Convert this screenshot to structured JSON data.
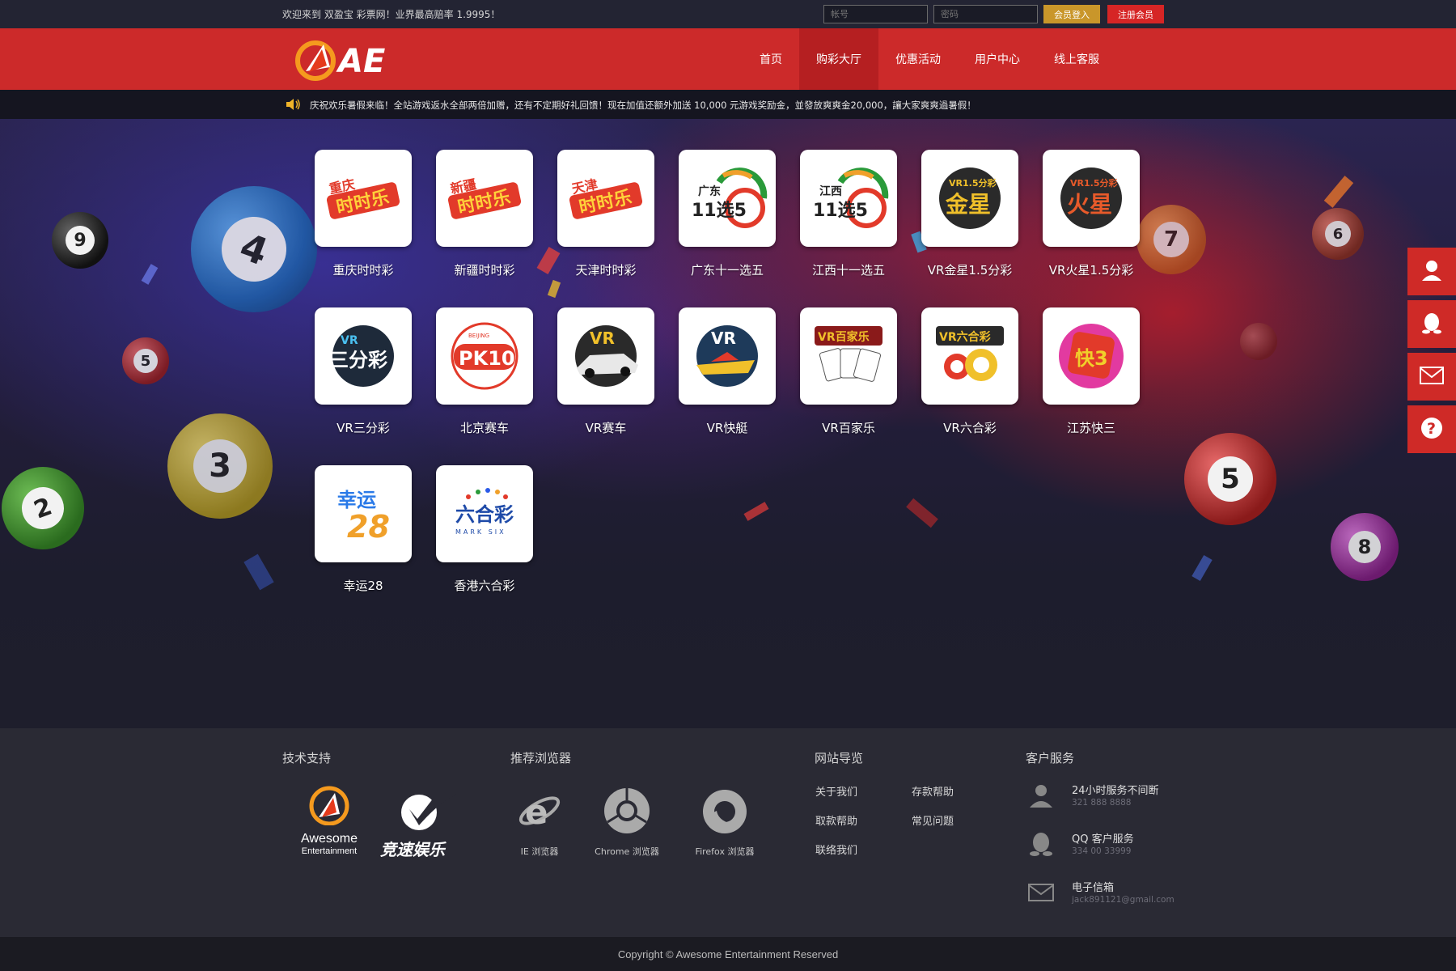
{
  "topbar": {
    "welcome": "欢迎来到 双盈宝 彩票网！业界最高赔率 1.9995！",
    "account_placeholder": "帐号",
    "password_placeholder": "密码",
    "login_label": "会员登入",
    "register_label": "注册会员"
  },
  "header": {
    "logo_text": "AE",
    "nav": [
      "首页",
      "购彩大厅",
      "优惠活动",
      "用户中心",
      "线上客服"
    ],
    "active_nav": "购彩大厅"
  },
  "marquee": {
    "text": "庆祝欢乐暑假来临！全站游戏返水全部两倍加赠，还有不定期好礼回馈！现在加值还额外加送 10,000 元游戏奖励金，並發放爽爽金20,000，讓大家爽爽過暑假！"
  },
  "games": [
    {
      "label": "重庆时时彩",
      "logo_top": "重庆",
      "logo_main": "时时乐"
    },
    {
      "label": "新疆时时彩",
      "logo_top": "新疆",
      "logo_main": "时时乐"
    },
    {
      "label": "天津时时彩",
      "logo_top": "天津",
      "logo_main": "时时乐"
    },
    {
      "label": "广东十一选五",
      "logo_top": "广东",
      "logo_main": "11选5"
    },
    {
      "label": "江西十一选五",
      "logo_top": "江西",
      "logo_main": "11选5"
    },
    {
      "label": "VR金星1.5分彩",
      "logo_top": "VR1.5分彩",
      "logo_main": "金星"
    },
    {
      "label": "VR火星1.5分彩",
      "logo_top": "VR1.5分彩",
      "logo_main": "火星"
    },
    {
      "label": "VR三分彩",
      "logo_top": "VR",
      "logo_main": "三分彩"
    },
    {
      "label": "北京赛车",
      "logo_top": "BEIJING",
      "logo_main": "PK10"
    },
    {
      "label": "VR赛车",
      "logo_top": "VR",
      "logo_main": ""
    },
    {
      "label": "VR快艇",
      "logo_top": "VR",
      "logo_main": ""
    },
    {
      "label": "VR百家乐",
      "logo_top": "VR百家乐",
      "logo_main": ""
    },
    {
      "label": "VR六合彩",
      "logo_top": "VR六合彩",
      "logo_main": ""
    },
    {
      "label": "江苏快三",
      "logo_top": "",
      "logo_main": "快3"
    },
    {
      "label": "幸运28",
      "logo_top": "幸运",
      "logo_main": "28"
    },
    {
      "label": "香港六合彩",
      "logo_top": "六合彩",
      "logo_main": "MARK SIX"
    }
  ],
  "footer": {
    "tech_title": "技术支持",
    "tech_brand_1": "Awesome",
    "tech_brand_1_sub": "Entertainment",
    "tech_brand_2": "竞速娱乐",
    "browsers_title": "推荐浏览器",
    "browsers": [
      "IE 浏览器",
      "Chrome 浏览器",
      "Firefox 浏览器"
    ],
    "nav_title": "网站导览",
    "nav_links": [
      "关于我们",
      "存款帮助",
      "取款帮助",
      "常见问题",
      "联络我们"
    ],
    "service_title": "客户服务",
    "services": [
      {
        "title": "24小时服务不间断",
        "value": "321 888 8888",
        "icon": "user-icon"
      },
      {
        "title": "QQ 客户服务",
        "value": "334 00 33999",
        "icon": "qq-icon"
      },
      {
        "title": "电子信箱",
        "value": "jack891121@gmail.com",
        "icon": "mail-icon"
      }
    ]
  },
  "copyright": "Copyright © Awesome Entertainment Reserved",
  "side_widget": [
    "user-icon",
    "qq-icon",
    "mail-icon",
    "help-icon"
  ],
  "colors": {
    "brand_red": "#cc2a2a",
    "gold": "#c9962a",
    "footer_bg": "#2a2a34"
  }
}
